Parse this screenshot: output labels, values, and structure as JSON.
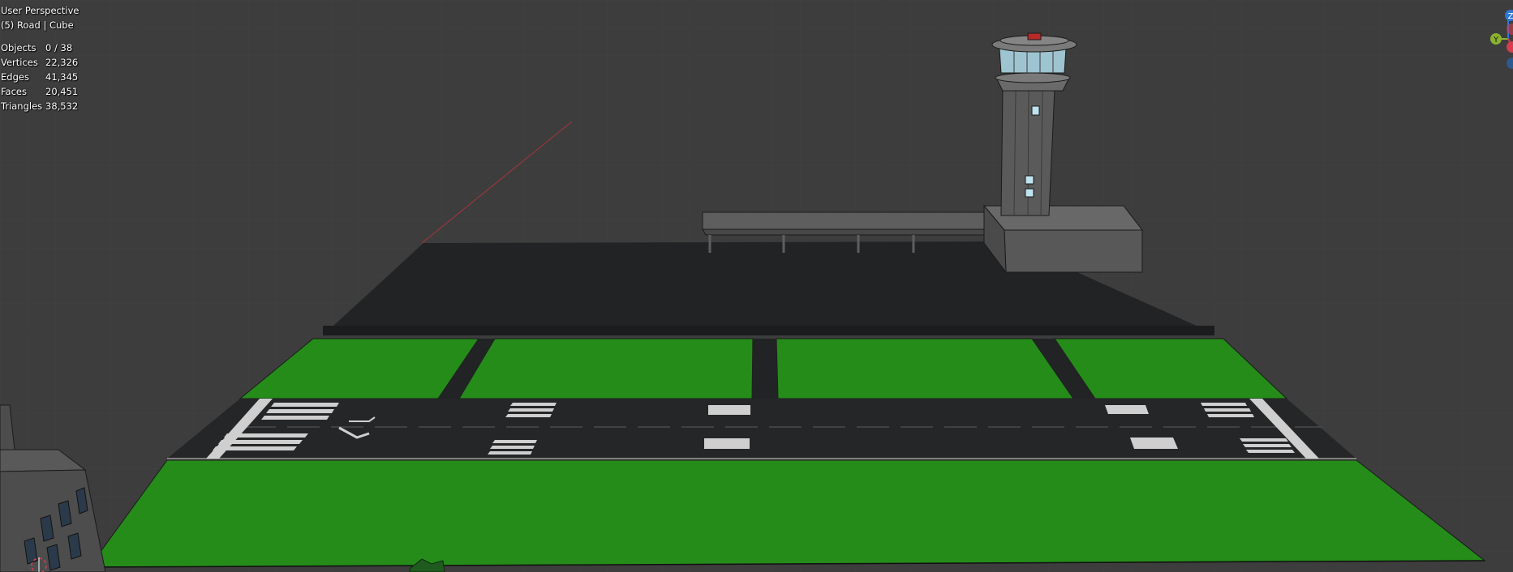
{
  "viewport": {
    "view_name": "User Perspective",
    "active_object": "(5) Road | Cube"
  },
  "stats": [
    {
      "label": "Objects",
      "value": "0 / 38"
    },
    {
      "label": "Vertices",
      "value": "22,326"
    },
    {
      "label": "Edges",
      "value": "41,345"
    },
    {
      "label": "Faces",
      "value": "20,451"
    },
    {
      "label": "Triangles",
      "value": "38,532"
    }
  ],
  "gizmo": {
    "z_label": "Z",
    "y_label": "Y",
    "colors": {
      "z": "#2d78d6",
      "y": "#8ab22e",
      "x": "#d63d4f"
    }
  },
  "colors": {
    "background": "#3d3d3d",
    "grass": "#258c1a",
    "tarmac": "#222324",
    "building": "#5e5e5e"
  }
}
